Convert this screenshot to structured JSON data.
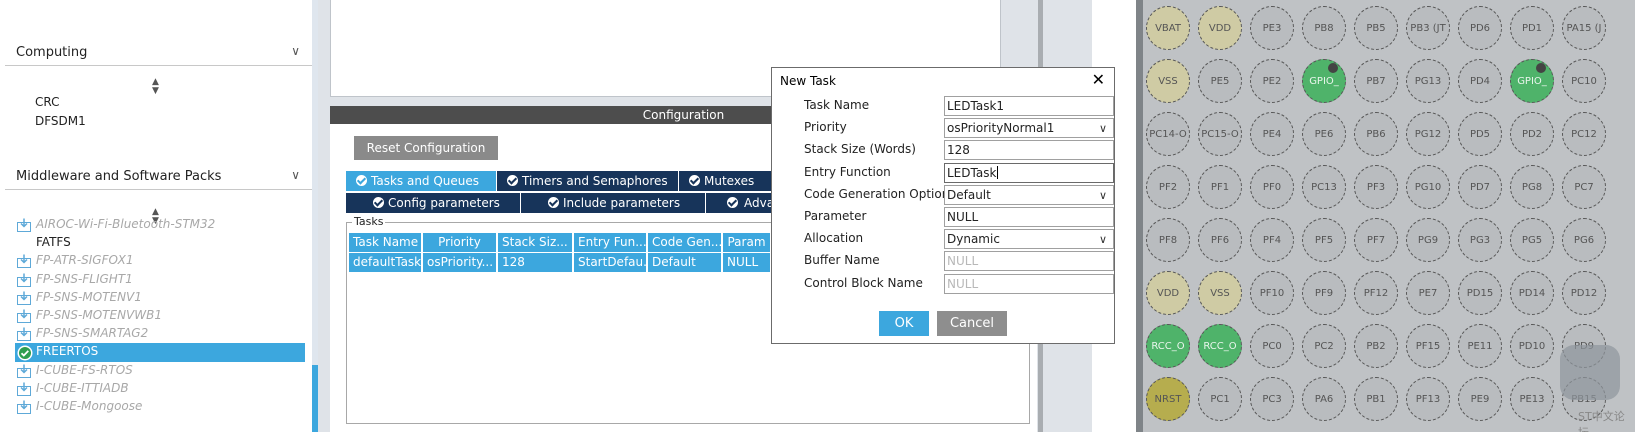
{
  "sidebar": {
    "computing": {
      "label": "Computing",
      "items": [
        "CRC",
        "DFSDM1"
      ]
    },
    "middleware": {
      "label": "Middleware and Software Packs",
      "items": [
        {
          "label": "AIROC-Wi-Fi-Bluetooth-STM32",
          "state": "disabled",
          "icon": "download-icon"
        },
        {
          "label": "FATFS",
          "state": "plain",
          "icon": ""
        },
        {
          "label": "FP-ATR-SIGFOX1",
          "state": "disabled",
          "icon": "download-icon"
        },
        {
          "label": "FP-SNS-FLIGHT1",
          "state": "disabled",
          "icon": "download-icon"
        },
        {
          "label": "FP-SNS-MOTENV1",
          "state": "disabled",
          "icon": "download-icon"
        },
        {
          "label": "FP-SNS-MOTENVWB1",
          "state": "disabled",
          "icon": "download-icon"
        },
        {
          "label": "FP-SNS-SMARTAG2",
          "state": "disabled",
          "icon": "download-icon"
        },
        {
          "label": "FREERTOS",
          "state": "selected",
          "icon": "check-circle-icon"
        },
        {
          "label": "I-CUBE-FS-RTOS",
          "state": "disabled",
          "icon": "download-icon"
        },
        {
          "label": "I-CUBE-ITTIADB",
          "state": "disabled",
          "icon": "download-icon"
        },
        {
          "label": "I-CUBE-Mongoose",
          "state": "disabled",
          "icon": "download-icon"
        }
      ]
    }
  },
  "config": {
    "title": "Configuration",
    "reset_label": "Reset Configuration",
    "tabs_row1": [
      "Tasks and Queues",
      "Timers and Semaphores",
      "Mutexes"
    ],
    "tabs_row2": [
      "Config parameters",
      "Include parameters",
      "Adva"
    ],
    "tasks_label": "Tasks",
    "columns": [
      "Task Name",
      "Priority",
      "Stack Siz...",
      "Entry Fun...",
      "Code Gen...",
      "Param"
    ],
    "rows": [
      [
        "defaultTask",
        "osPriority...",
        "128",
        "StartDefau...",
        "Default",
        "NULL"
      ]
    ]
  },
  "dialog": {
    "title": "New Task",
    "close_glyph": "✕",
    "fields": [
      {
        "label": "Task Name",
        "value": "LEDTask1",
        "type": "text"
      },
      {
        "label": "Priority",
        "value": "osPriorityNormal1",
        "type": "select"
      },
      {
        "label": "Stack Size (Words)",
        "value": "128",
        "type": "text"
      },
      {
        "label": "Entry Function",
        "value": "LEDTask",
        "type": "text"
      },
      {
        "label": "Code Generation Option",
        "value": "Default",
        "type": "select"
      },
      {
        "label": "Parameter",
        "value": "NULL",
        "type": "text"
      },
      {
        "label": "Allocation",
        "value": "Dynamic",
        "type": "select"
      },
      {
        "label": "Buffer Name",
        "value": "NULL",
        "type": "placeholder"
      },
      {
        "label": "Control Block Name",
        "value": "NULL",
        "type": "placeholder"
      }
    ],
    "ok_label": "OK",
    "cancel_label": "Cancel"
  },
  "pins": {
    "rows": [
      [
        "VBAT",
        "VDD",
        "PE3",
        "PB8",
        "PB5",
        "PB3 (JT",
        "PD6",
        "PD1",
        "PA15 (J"
      ],
      [
        "VSS",
        "PE5",
        "PE2",
        "GPIO_",
        "PB7",
        "PG13",
        "PD4",
        "GPIO_",
        "PC10"
      ],
      [
        "PC14-O",
        "PC15-O",
        "PE4",
        "PE6",
        "PB6",
        "PG12",
        "PD5",
        "PD2",
        "PC12"
      ],
      [
        "PF2",
        "PF1",
        "PF0",
        "PC13",
        "PF3",
        "PG10",
        "PD7",
        "PG8",
        "PC7"
      ],
      [
        "PF8",
        "PF6",
        "PF4",
        "PF5",
        "PF7",
        "PG9",
        "PG3",
        "PG5",
        "PG6"
      ],
      [
        "VDD",
        "VSS",
        "PF10",
        "PF9",
        "PF12",
        "PE7",
        "PD15",
        "PD14",
        "PD12"
      ],
      [
        "RCC_O",
        "RCC_O",
        "PC0",
        "PC2",
        "PB2",
        "PF15",
        "PE11",
        "PD10",
        "PD9"
      ],
      [
        "NRST",
        "PC1",
        "PC3",
        "PA6",
        "PB1",
        "PF13",
        "PE9",
        "PE13",
        "PB15"
      ]
    ],
    "power_pins": [
      "VBAT",
      "VDD",
      "VSS"
    ],
    "green_pins": [
      "GPIO_",
      "RCC_O"
    ],
    "reset_pins": [
      "NRST"
    ],
    "colors": {
      "accent": "#3ca7de",
      "dark_tab": "#17345a",
      "pin_green": "#4fb36a",
      "pin_power": "#cfcba4"
    }
  },
  "watermark": "ST中文论坛"
}
